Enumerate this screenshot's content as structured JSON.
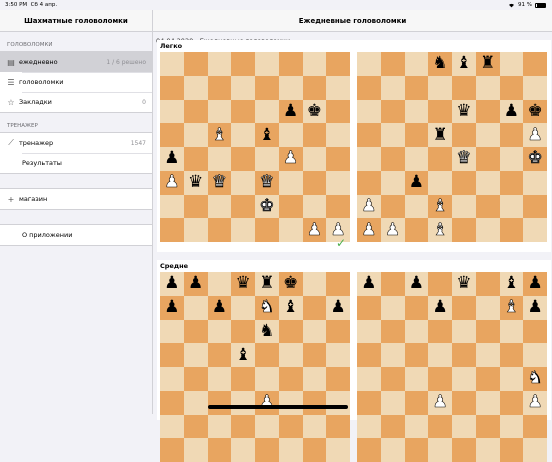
{
  "status": {
    "time": "3:50 PM",
    "date": "Сб 4 апр.",
    "battery": "91 %"
  },
  "sidebar": {
    "title": "Шахматные головоломки",
    "sections": [
      {
        "header": "ГОЛОВОЛОМКИ",
        "items": [
          {
            "icon": "calendar-icon",
            "glyph": "▤",
            "label": "ежедневно",
            "value": "1 / 6 решено",
            "selected": true
          },
          {
            "icon": "list-icon",
            "glyph": "☰",
            "label": "головоломки",
            "value": ""
          },
          {
            "icon": "star-icon",
            "glyph": "☆",
            "label": "Закладки",
            "value": "0"
          }
        ]
      },
      {
        "header": "ТРЕНАЖЕР",
        "items": [
          {
            "icon": "graph-icon",
            "glyph": "⟋",
            "label": "тренажер",
            "value": "1547"
          },
          {
            "icon": "",
            "glyph": "",
            "label": "Результаты",
            "value": ""
          }
        ]
      },
      {
        "header": "",
        "items": [
          {
            "icon": "plus-icon",
            "glyph": "+",
            "label": "магазин",
            "value": ""
          }
        ]
      },
      {
        "header": "",
        "items": [
          {
            "icon": "",
            "glyph": "",
            "label": "О приложении",
            "value": ""
          }
        ]
      }
    ]
  },
  "main": {
    "title": "Ежедневные головоломки",
    "date_line": "04.04.2020 - Ежедневные головоломки",
    "panels": [
      {
        "label": "Легко",
        "boards": [
          {
            "solved": true,
            "rows": [
              "........",
              "........",
              ".....pk.",
              "..B.b...",
              "p....P..",
              "PqQ.Q...",
              "....K...",
              "......PP"
            ]
          },
          {
            "solved": false,
            "rows": [
              "...nbr..",
              "........",
              "....q.pk",
              "...r...P",
              "....Q..K",
              "..p.....",
              "P..B....",
              "PP.B....",
              "......K."
            ]
          }
        ]
      },
      {
        "label": "Средне",
        "boards": [
          {
            "solved": false,
            "rows": [
              "pp.qrk..",
              "p.p.Nb.p",
              "....n...",
              "...b....",
              "........",
              "....P..."
            ]
          },
          {
            "solved": false,
            "rows": [
              "p.p.q.bp",
              "...p..Bp",
              "........",
              "........",
              ".......N",
              "...P...P"
            ]
          }
        ]
      }
    ]
  }
}
